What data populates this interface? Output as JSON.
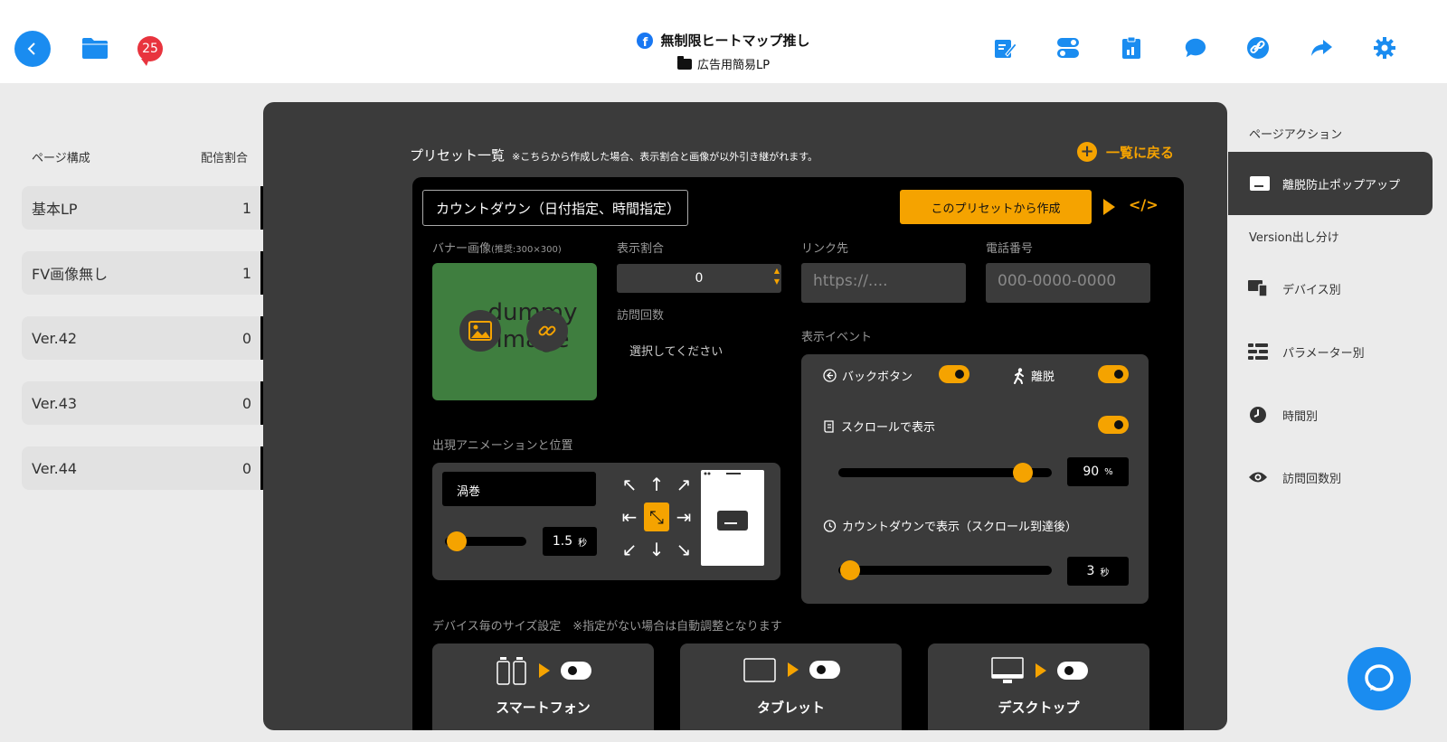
{
  "header": {
    "notification_count": "25",
    "title": "無制限ヒートマップ推し",
    "subtitle": "広告用簡易LP",
    "tools": [
      "edit-icon",
      "toggle-settings-icon",
      "report-icon",
      "chat-bubble-icon",
      "link-icon",
      "share-icon",
      "gear-icon"
    ]
  },
  "left": {
    "col_pages": "ページ構成",
    "col_ratio": "配信割合",
    "pages": [
      {
        "name": "基本LP",
        "ratio": "1"
      },
      {
        "name": "FV画像無し",
        "ratio": "1"
      },
      {
        "name": "Ver.42",
        "ratio": "0"
      },
      {
        "name": "Ver.43",
        "ratio": "0"
      },
      {
        "name": "Ver.44",
        "ratio": "0"
      }
    ]
  },
  "main": {
    "preset_title": "プリセット一覧",
    "preset_note": "※こちらから作成した場合、表示割合と画像が以外引き継がれます。",
    "back_to_list": "一覧に戻る",
    "preset_select": "カウントダウン（日付指定、時間指定）",
    "create_btn": "このプリセットから作成",
    "banner_label": "バナー画像",
    "banner_hint": "(推奨:300×300)",
    "banner_dummy": "dummy image",
    "display_ratio_label": "表示割合",
    "display_ratio_value": "0",
    "visit_count_label": "訪問回数",
    "visit_count_placeholder": "選択してください",
    "link_label": "リンク先",
    "link_placeholder": "https://....",
    "phone_label": "電話番号",
    "phone_placeholder": "000-0000-0000",
    "event_label": "表示イベント",
    "back_button_label": "バックボタン",
    "exit_label": "離脱",
    "scroll_label": "スクロールで表示",
    "scroll_value": "90",
    "scroll_unit": "%",
    "scroll_percent": 90,
    "countdown_label": "カウントダウンで表示（スクロール到達後）",
    "countdown_value": "3",
    "countdown_unit": "秒",
    "anim_label": "出現アニメーションと位置",
    "anim_select": "渦巻",
    "anim_value": "1.5",
    "anim_unit": "秒",
    "device_note": "デバイス毎のサイズ設定　※指定がない場合は自動調整となります",
    "devices": [
      {
        "name": "スマートフォン",
        "icon": "smartphone-icon"
      },
      {
        "name": "タブレット",
        "icon": "tablet-icon"
      },
      {
        "name": "デスクトップ",
        "icon": "desktop-icon"
      }
    ]
  },
  "right": {
    "section_action": "ページアクション",
    "active_item": "離脱防止ポップアップ",
    "section_version": "Version出し分け",
    "items": [
      {
        "label": "デバイス別",
        "icon": "devices-icon"
      },
      {
        "label": "パラメーター別",
        "icon": "parameter-icon"
      },
      {
        "label": "時間別",
        "icon": "clock-icon"
      },
      {
        "label": "訪問回数別",
        "icon": "eye-icon"
      }
    ]
  },
  "colors": {
    "accent": "#f5a300",
    "primary": "#1a8cf0",
    "panel": "#3b3b3b",
    "badge": "#e8343e"
  }
}
